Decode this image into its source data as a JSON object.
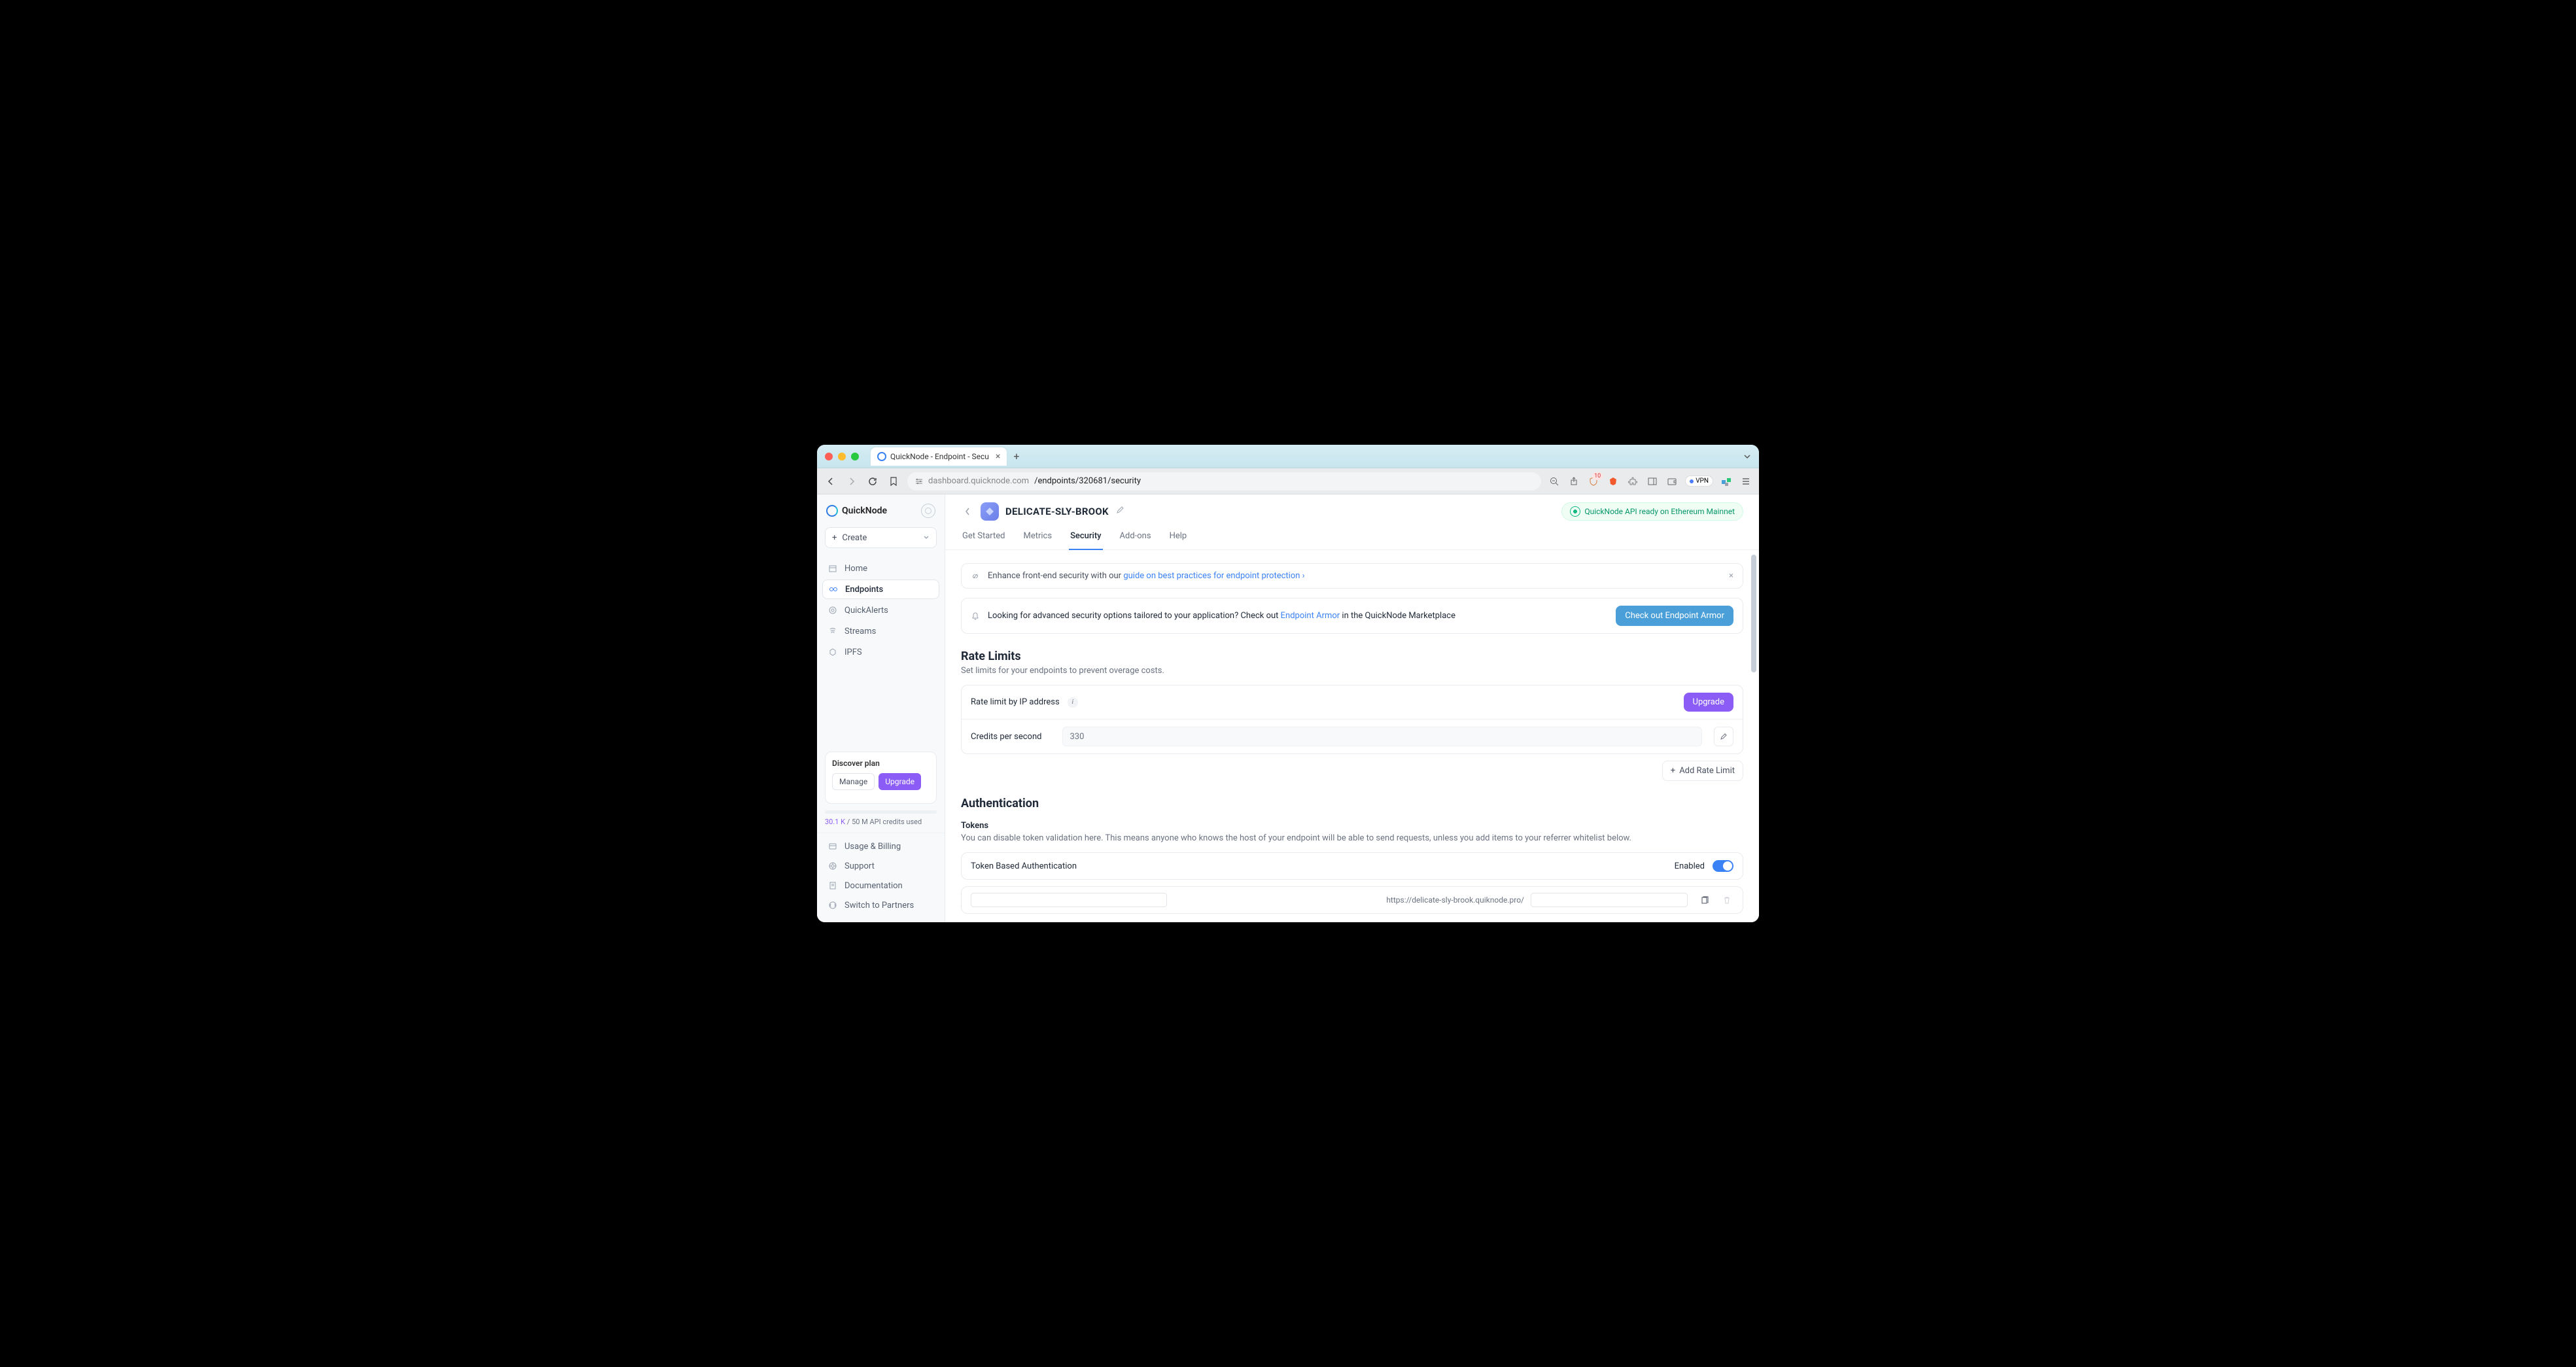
{
  "browser": {
    "tab_title": "QuickNode - Endpoint - Secu",
    "url_host": "dashboard.quicknode.com",
    "url_path": "/endpoints/320681/security",
    "vpn_label": "VPN",
    "shield_badge": "10"
  },
  "sidebar": {
    "brand": "QuickNode",
    "create_label": "Create",
    "nav": [
      {
        "label": "Home"
      },
      {
        "label": "Endpoints"
      },
      {
        "label": "QuickAlerts"
      },
      {
        "label": "Streams"
      },
      {
        "label": "IPFS"
      }
    ],
    "plan": {
      "title": "Discover plan",
      "manage": "Manage",
      "upgrade": "Upgrade",
      "credits_used": "30.1 K",
      "credits_total": " / 50 M API credits used"
    },
    "footer": [
      {
        "label": "Usage & Billing"
      },
      {
        "label": "Support"
      },
      {
        "label": "Documentation"
      },
      {
        "label": "Switch to Partners"
      }
    ]
  },
  "page": {
    "title": "DELICATE-SLY-BROOK",
    "status": "QuickNode API ready on Ethereum Mainnet",
    "tabs": [
      "Get Started",
      "Metrics",
      "Security",
      "Add-ons",
      "Help"
    ]
  },
  "banner_guide": {
    "prefix": "Enhance front-end security with our ",
    "link": "guide on best practices for endpoint protection"
  },
  "banner_armor": {
    "prefix": "Looking for advanced security options tailored to your application? Check out ",
    "link": "Endpoint Armor",
    "suffix": " in the QuickNode Marketplace",
    "cta": "Check out Endpoint Armor"
  },
  "rate_limits": {
    "title": "Rate Limits",
    "subtitle": "Set limits for your endpoints to prevent overage costs.",
    "row_ip": "Rate limit by IP address",
    "upgrade": "Upgrade",
    "row_cps_label": "Credits per second",
    "row_cps_value": "330",
    "add_btn": "Add Rate Limit"
  },
  "auth": {
    "title": "Authentication",
    "tokens_title": "Tokens",
    "tokens_desc": "You can disable token validation here. This means anyone who knows the host of your endpoint will be able to send requests, unless you add items to your referrer whitelist below.",
    "tba_label": "Token Based Authentication",
    "tba_status": "Enabled",
    "token_url_prefix": "https://delicate-sly-brook.quiknode.pro/"
  }
}
